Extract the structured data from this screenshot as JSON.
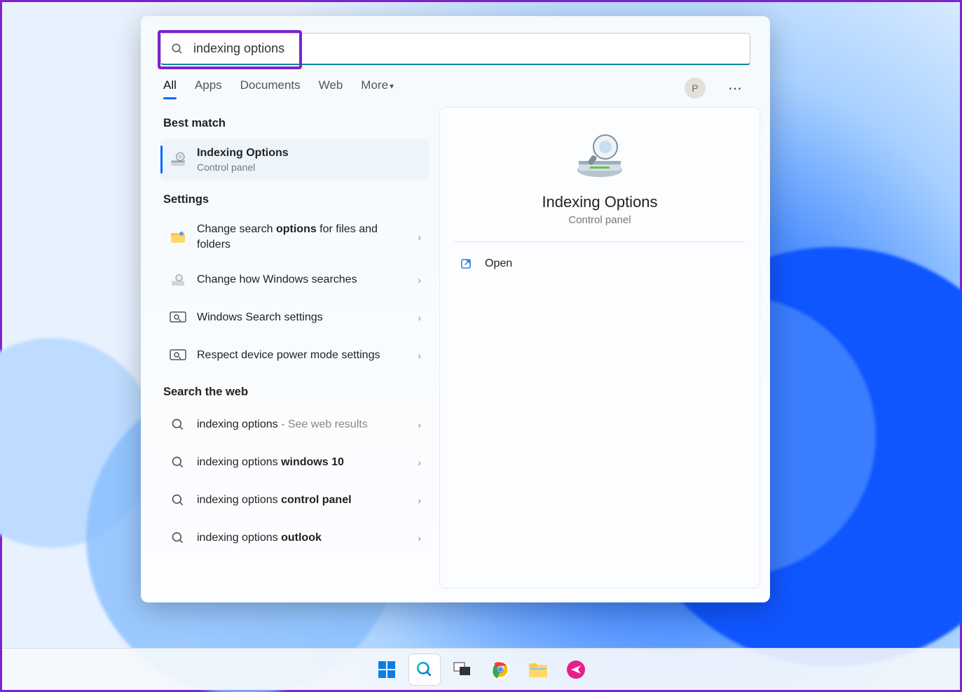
{
  "search": {
    "value": "indexing options"
  },
  "tabs": {
    "all": "All",
    "apps": "Apps",
    "documents": "Documents",
    "web": "Web",
    "more": "More"
  },
  "user_initial": "P",
  "sections": {
    "best_match": "Best match",
    "settings": "Settings",
    "web": "Search the web"
  },
  "best_match": {
    "title": "Indexing Options",
    "subtitle": "Control panel"
  },
  "settings_items": [
    {
      "pre": "Change search ",
      "bold": "options",
      "post": " for files and folders"
    },
    {
      "pre": "Change how Windows searches",
      "bold": "",
      "post": ""
    },
    {
      "pre": "Windows Search settings",
      "bold": "",
      "post": ""
    },
    {
      "pre": "Respect device power mode settings",
      "bold": "",
      "post": ""
    }
  ],
  "web_items": [
    {
      "pre": "indexing options",
      "bold": "",
      "suffix": " - See web results"
    },
    {
      "pre": "indexing options ",
      "bold": "windows 10",
      "suffix": ""
    },
    {
      "pre": "indexing options ",
      "bold": "control panel",
      "suffix": ""
    },
    {
      "pre": "indexing options ",
      "bold": "outlook",
      "suffix": ""
    }
  ],
  "detail": {
    "title": "Indexing Options",
    "subtitle": "Control panel",
    "open": "Open"
  }
}
